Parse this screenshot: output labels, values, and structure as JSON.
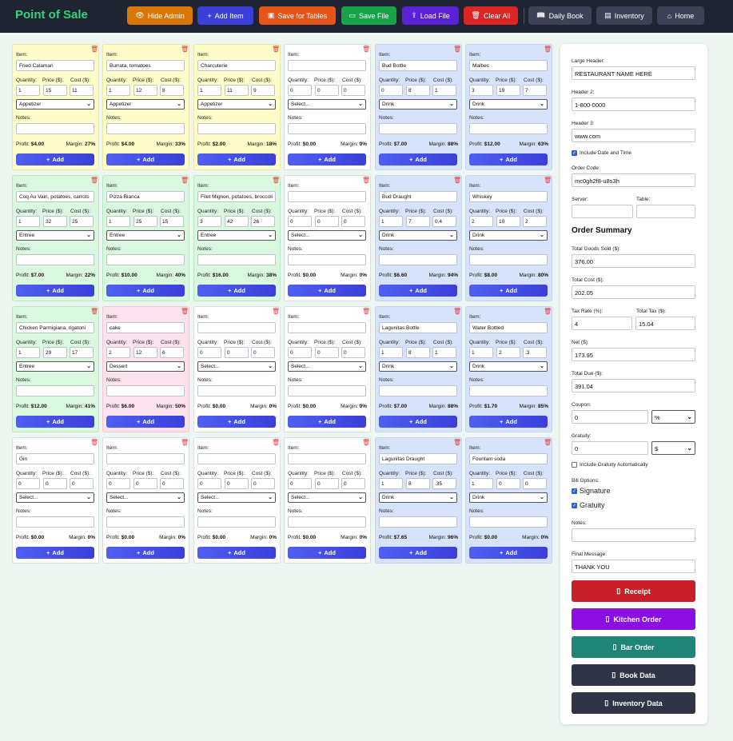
{
  "app": {
    "title": "Point of Sale"
  },
  "toolbar": [
    {
      "label": "Hide Admin",
      "icon": "👁",
      "color": "#d97706",
      "name": "hide-admin-button"
    },
    {
      "label": "Add Item",
      "icon": "+",
      "color": "#3b3fd8",
      "name": "add-item-button"
    },
    {
      "label": "Save for Tables",
      "icon": "▣",
      "color": "#e5541b",
      "name": "save-for-tables-button"
    },
    {
      "label": "Save File",
      "icon": "▭",
      "color": "#16a34a",
      "name": "save-file-button"
    },
    {
      "label": "Load File",
      "icon": "⇪",
      "color": "#5b21d6",
      "name": "load-file-button"
    },
    {
      "label": "Clear All",
      "icon": "🗑",
      "color": "#dc2626",
      "name": "clear-all-button"
    },
    {
      "label": "Daily Book",
      "icon": "📖",
      "color": "#3d4356",
      "name": "daily-book-button"
    },
    {
      "label": "Inventory",
      "icon": "▤",
      "color": "#3d4356",
      "name": "inventory-button"
    },
    {
      "label": "Home",
      "icon": "⌂",
      "color": "#3d4356",
      "name": "home-button"
    }
  ],
  "labels": {
    "item": "Item:",
    "quantity": "Quantity:",
    "price": "Price ($):",
    "cost": "Cost ($):",
    "notes": "Notes:",
    "profit": "Profit:",
    "margin": "Margin:",
    "add": "Add",
    "select_placeholder": "Select..."
  },
  "items": [
    {
      "name": "Fried Calamari",
      "qty": "1",
      "price": "15",
      "cost": "11",
      "category": "Appetizer",
      "profit": "$4.00",
      "margin": "27%"
    },
    {
      "name": "Burrata, tomatoes",
      "qty": "1",
      "price": "12",
      "cost": "8",
      "category": "Appetizer",
      "profit": "$4.00",
      "margin": "33%"
    },
    {
      "name": "Charcuterie",
      "qty": "1",
      "price": "11",
      "cost": "9",
      "category": "Appetizer",
      "profit": "$2.00",
      "margin": "18%"
    },
    {
      "name": "",
      "qty": "0",
      "price": "0",
      "cost": "0",
      "category": "",
      "profit": "$0.00",
      "margin": "0%"
    },
    {
      "name": "Bud Bottle",
      "qty": "0",
      "price": "8",
      "cost": "1",
      "category": "Drink",
      "profit": "$7.00",
      "margin": "88%"
    },
    {
      "name": "Malbec",
      "qty": "3",
      "price": "19",
      "cost": "7",
      "category": "Drink",
      "profit": "$12.00",
      "margin": "63%"
    },
    {
      "name": "Coq Au Vain, potatoes, carrots",
      "qty": "1",
      "price": "32",
      "cost": "25",
      "category": "Entree",
      "profit": "$7.00",
      "margin": "22%"
    },
    {
      "name": "Pizza Bianca",
      "qty": "1",
      "price": "25",
      "cost": "15",
      "category": "Entree",
      "profit": "$10.00",
      "margin": "40%"
    },
    {
      "name": "Filet Mignon, potatoes, broccoli",
      "qty": "3",
      "price": "42",
      "cost": "26",
      "category": "Entree",
      "profit": "$16.00",
      "margin": "38%"
    },
    {
      "name": "",
      "qty": "0",
      "price": "0",
      "cost": "0",
      "category": "",
      "profit": "$0.00",
      "margin": "0%"
    },
    {
      "name": "Bud Draught",
      "qty": "1",
      "price": "7",
      "cost": "0.4",
      "category": "Drink",
      "profit": "$6.60",
      "margin": "94%"
    },
    {
      "name": "Whiskey",
      "qty": "2",
      "price": "10",
      "cost": "2",
      "category": "Drink",
      "profit": "$8.00",
      "margin": "80%"
    },
    {
      "name": "Chicken Parmigiana, rigatoni",
      "qty": "1",
      "price": "29",
      "cost": "17",
      "category": "Entree",
      "profit": "$12.00",
      "margin": "41%"
    },
    {
      "name": "cake",
      "qty": "2",
      "price": "12",
      "cost": "6",
      "category": "Dessert",
      "profit": "$6.00",
      "margin": "50%"
    },
    {
      "name": "",
      "qty": "0",
      "price": "0",
      "cost": "0",
      "category": "",
      "profit": "$0.00",
      "margin": "0%"
    },
    {
      "name": "",
      "qty": "0",
      "price": "0",
      "cost": "0",
      "category": "",
      "profit": "$0.00",
      "margin": "0%"
    },
    {
      "name": "Lagunitas Bottle",
      "qty": "1",
      "price": "8",
      "cost": "1",
      "category": "Drink",
      "profit": "$7.00",
      "margin": "88%"
    },
    {
      "name": "Water Bottled",
      "qty": "1",
      "price": "2",
      "cost": ".3",
      "category": "Drink",
      "profit": "$1.70",
      "margin": "85%"
    },
    {
      "name": "Gin",
      "qty": "0",
      "price": "0",
      "cost": "0",
      "category": "",
      "profit": "$0.00",
      "margin": "0%"
    },
    {
      "name": "",
      "qty": "0",
      "price": "0",
      "cost": "0",
      "category": "",
      "profit": "$0.00",
      "margin": "0%"
    },
    {
      "name": "",
      "qty": "0",
      "price": "0",
      "cost": "0",
      "category": "",
      "profit": "$0.00",
      "margin": "0%"
    },
    {
      "name": "",
      "qty": "0",
      "price": "0",
      "cost": "0",
      "category": "",
      "profit": "$0.00",
      "margin": "0%"
    },
    {
      "name": "Lagunitas Draught",
      "qty": "1",
      "price": "8",
      "cost": ".35",
      "category": "Drink",
      "profit": "$7.65",
      "margin": "96%"
    },
    {
      "name": "Fountain soda",
      "qty": "1",
      "price": "0",
      "cost": "0",
      "category": "Drink",
      "profit": "$0.00",
      "margin": "0%"
    }
  ],
  "panel": {
    "large_header_label": "Large Header:",
    "large_header": "RESTAURANT NAME HERE",
    "header2_label": "Header 2:",
    "header2": "1-800-0000",
    "header3_label": "Header 3:",
    "header3": "www.com",
    "include_datetime": "Include Date and Time",
    "order_code_label": "Order Code:",
    "order_code": "mc0gh2f8-u8s3h",
    "server_label": "Server:",
    "table_label": "Table:",
    "summary_title": "Order Summary",
    "total_goods_label": "Total Goods Sold ($):",
    "total_goods": "376.00",
    "total_cost_label": "Total Cost ($):",
    "total_cost": "202.05",
    "tax_rate_label": "Tax Rate (%):",
    "tax_rate": "4",
    "total_tax_label": "Total Tax ($):",
    "total_tax": "15.04",
    "net_label": "Net ($):",
    "net": "173.95",
    "total_due_label": "Total Due ($):",
    "total_due": "391.04",
    "coupon_label": "Coupon:",
    "coupon": "0",
    "coupon_type": "%",
    "gratuity_label": "Gratuity:",
    "gratuity": "0",
    "gratuity_type": "$",
    "include_gratuity": "Include Gratuity Automatically",
    "bill_options_label": "Bill Options:",
    "signature": "Signature",
    "gratuity_option": "Gratuity",
    "notes_label": "Notes:",
    "final_message_label": "Final Message:",
    "final_message": "THANK YOU",
    "buttons": [
      {
        "label": "Receipt",
        "color": "#c8202a",
        "name": "receipt-button"
      },
      {
        "label": "Kitchen Order",
        "color": "#8b0fe0",
        "name": "kitchen-order-button"
      },
      {
        "label": "Bar Order",
        "color": "#1e8577",
        "name": "bar-order-button"
      },
      {
        "label": "Book Data",
        "color": "#2f3547",
        "name": "book-data-button"
      },
      {
        "label": "Inventory Data",
        "color": "#2f3547",
        "name": "inventory-data-button"
      }
    ]
  }
}
